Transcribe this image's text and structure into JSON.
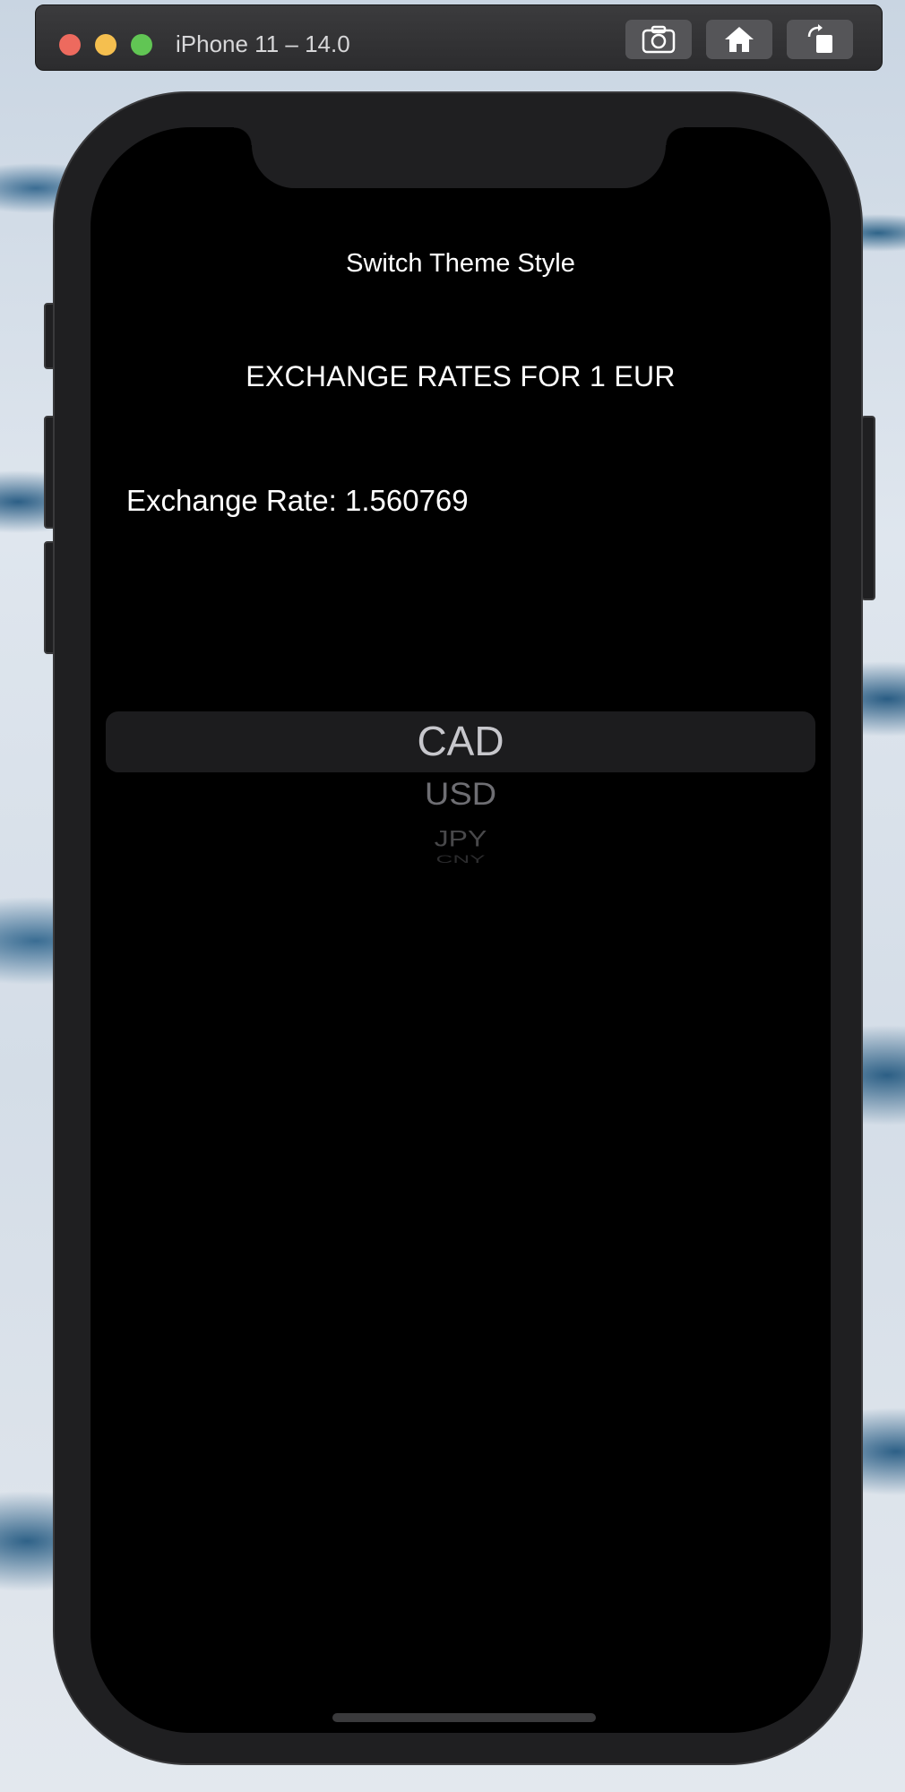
{
  "simulator": {
    "title": "iPhone 11 – 14.0",
    "buttons": [
      {
        "icon": "camera-icon",
        "action": "screenshot"
      },
      {
        "icon": "home-icon",
        "action": "home"
      },
      {
        "icon": "rotate-icon",
        "action": "rotate"
      }
    ]
  },
  "app": {
    "theme_button_label": "Switch Theme Style",
    "header_title": "EXCHANGE RATES FOR 1 EUR",
    "exchange_rate_label": "Exchange Rate: 1.560769",
    "picker": {
      "selected": "CAD",
      "visible_options": [
        "CAD",
        "USD",
        "JPY",
        "CNY"
      ]
    }
  },
  "colors": {
    "screen_background": "#000000",
    "text_primary": "#ffffff",
    "picker_selected_text": "#c7c7cc",
    "picker_highlight": "#1c1c1e"
  }
}
